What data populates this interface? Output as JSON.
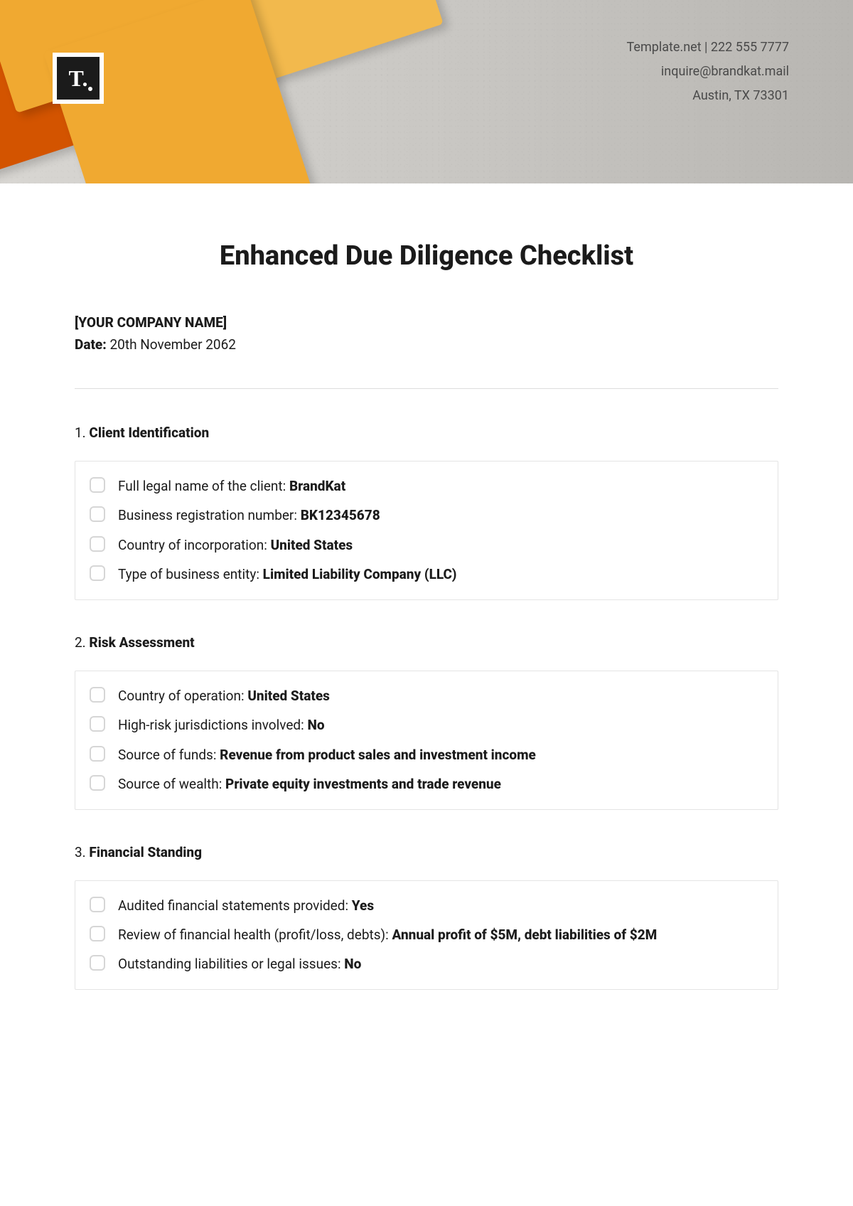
{
  "header": {
    "line1": "Template.net  |  222 555 7777",
    "line2": "inquire@brandkat.mail",
    "line3": "Austin, TX 73301",
    "logo_letter": "T."
  },
  "title": "Enhanced Due Diligence Checklist",
  "company_placeholder": "[YOUR COMPANY NAME]",
  "date_label": "Date:",
  "date_value": "20th November 2062",
  "sections": [
    {
      "num": "1.",
      "label": "Client Identification",
      "items": [
        {
          "text": "Full legal name of the client: ",
          "value": "BrandKat"
        },
        {
          "text": "Business registration number: ",
          "value": "BK12345678"
        },
        {
          "text": "Country of incorporation: ",
          "value": "United States"
        },
        {
          "text": "Type of business entity: ",
          "value": "Limited Liability Company (LLC)"
        }
      ]
    },
    {
      "num": "2.",
      "label": "Risk Assessment",
      "items": [
        {
          "text": "Country of operation: ",
          "value": "United States"
        },
        {
          "text": "High-risk jurisdictions involved: ",
          "value": "No"
        },
        {
          "text": "Source of funds: ",
          "value": "Revenue from product sales and investment income"
        },
        {
          "text": "Source of wealth: ",
          "value": "Private equity investments and trade revenue"
        }
      ]
    },
    {
      "num": "3.",
      "label": "Financial Standing",
      "items": [
        {
          "text": "Audited financial statements provided: ",
          "value": "Yes"
        },
        {
          "text": "Review of financial health (profit/loss, debts): ",
          "value": "Annual profit of $5M, debt liabilities of $2M"
        },
        {
          "text": "Outstanding liabilities or legal issues: ",
          "value": "No"
        }
      ]
    }
  ]
}
